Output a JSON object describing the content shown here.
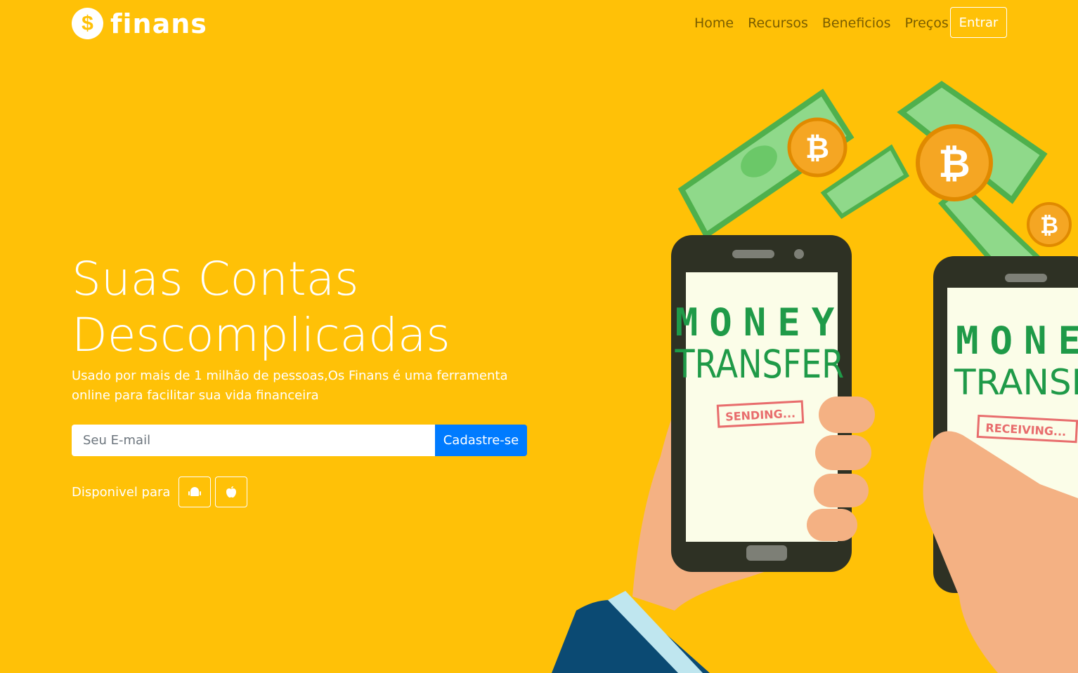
{
  "brand": {
    "icon_glyph": "$",
    "name": "finans"
  },
  "nav": {
    "links": [
      "Home",
      "Recursos",
      "Beneficios",
      "Preços"
    ],
    "login_label": "Entrar"
  },
  "hero": {
    "title_line1": "Suas Contas",
    "title_line2": "Descomplicadas",
    "subtitle": "Usado por mais de 1 milhão de pessoas,Os Finans é uma ferramenta online para facilitar sua vida financeira",
    "email_placeholder": "Seu E-mail",
    "signup_label": "Cadastre-se",
    "available_label": "Disponivel para",
    "stores": [
      "android-icon",
      "apple-icon"
    ]
  },
  "illustration": {
    "phone1": {
      "line1": "MONEY",
      "line2": "TRANSFER",
      "status": "SENDING..."
    },
    "phone2": {
      "line1": "MONE",
      "line2": "TRANSFE",
      "status": "RECEIVING..."
    }
  },
  "colors": {
    "background": "#ffc107",
    "primary": "#007bff",
    "cash": "#8fd98a",
    "coin": "#f5a623"
  }
}
